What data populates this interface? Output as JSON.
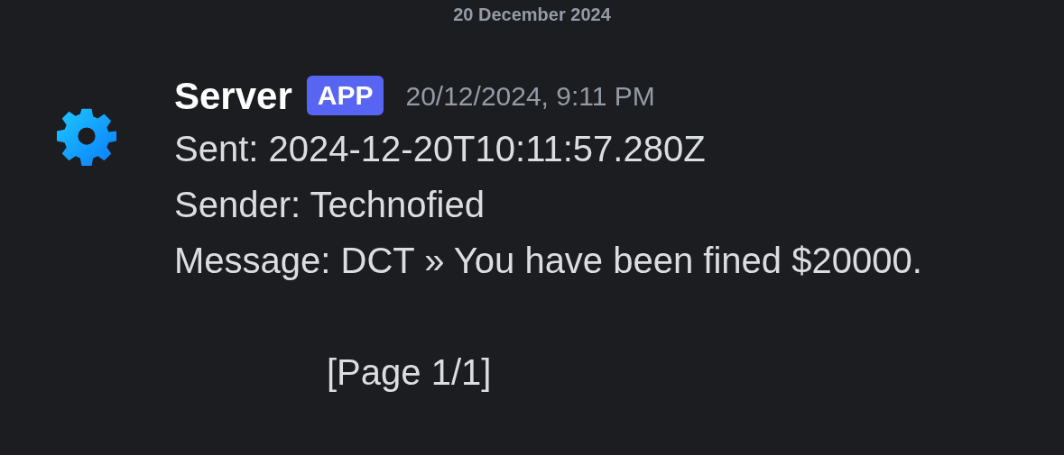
{
  "date_divider": "20 December 2024",
  "message": {
    "author": "Server",
    "badge": "APP",
    "timestamp": "20/12/2024, 9:11 PM",
    "lines": [
      "Sent: 2024-12-20T10:11:57.280Z",
      "Sender: Technofied",
      "Message: DCT » You have been fined $20000."
    ],
    "footer": "[Page 1/1]"
  }
}
